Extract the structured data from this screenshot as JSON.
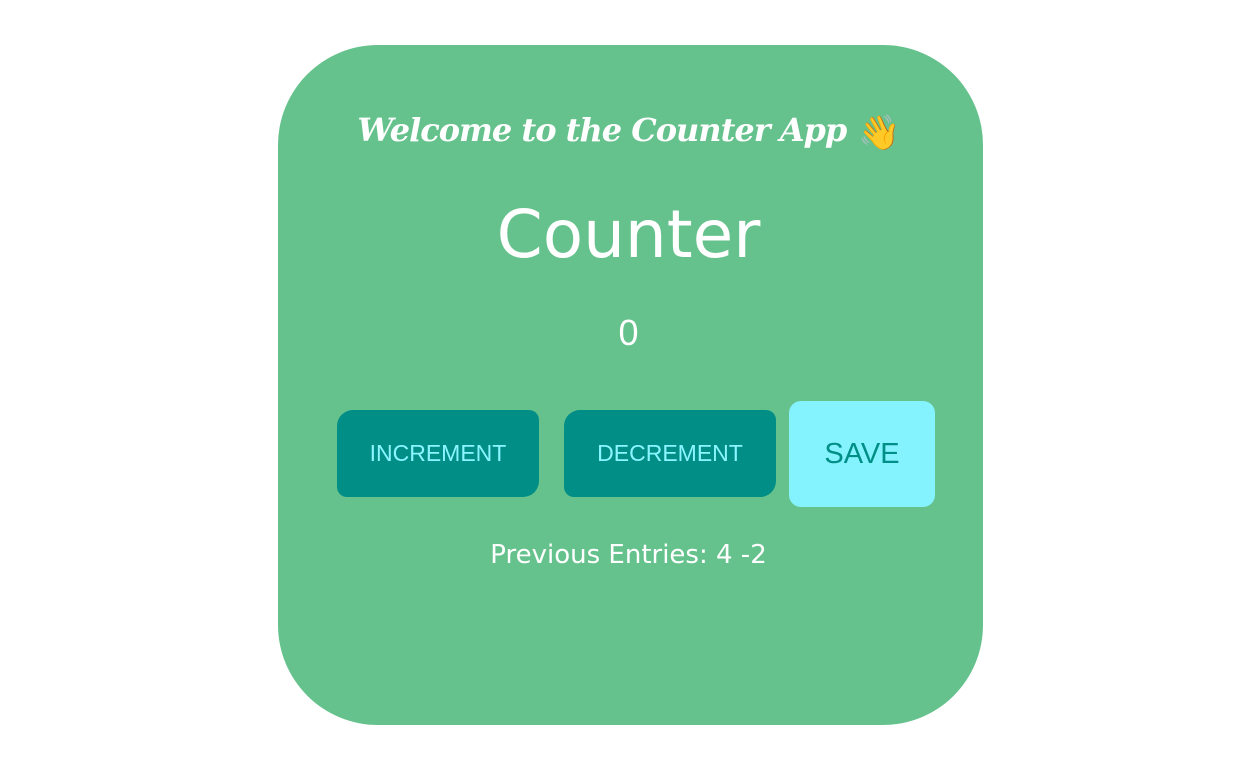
{
  "app": {
    "welcome_text": "Welcome to the Counter App",
    "welcome_emoji": "👋",
    "title": "Counter",
    "count_value": "0"
  },
  "buttons": {
    "increment_label": "Increment",
    "decrement_label": "Decrement",
    "save_label": "Save"
  },
  "entries": {
    "label": "Previous Entries:",
    "values": "4 -2"
  },
  "colors": {
    "card_background": "#66c28c",
    "button_primary": "#008e87",
    "button_primary_text": "#8af5ff",
    "button_save": "#84f3fd",
    "button_save_text": "#008e87"
  }
}
